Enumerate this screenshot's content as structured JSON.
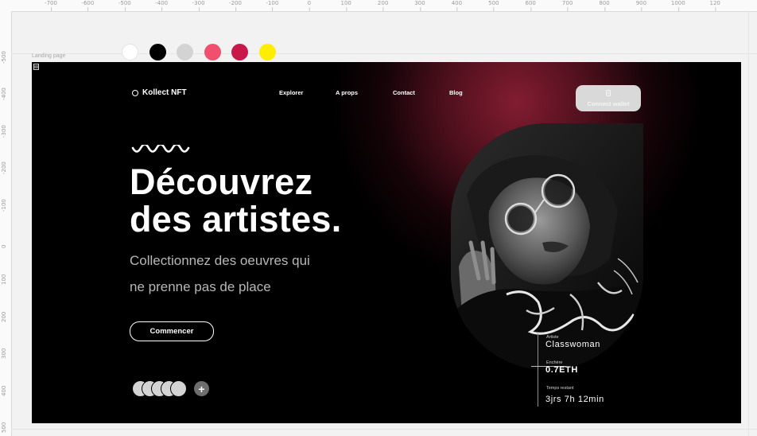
{
  "ruler": {
    "top": [
      "-700",
      "-600",
      "-500",
      "-400",
      "-300",
      "-200",
      "-100",
      "0",
      "100",
      "200",
      "300",
      "400",
      "500",
      "600",
      "700",
      "800",
      "900",
      "1000",
      "120"
    ],
    "left": [
      "-500",
      "-400",
      "-300",
      "-200",
      "-100",
      "0",
      "100",
      "200",
      "300",
      "400",
      "500"
    ]
  },
  "palette": [
    "#ffffff",
    "#000000",
    "#d3d3d3",
    "#f0506e",
    "#c8184b",
    "#ffee00"
  ],
  "frame_label": "Landing page",
  "nav": {
    "logo_text": "Kollect NFT",
    "links": [
      "Explorer",
      "A props",
      "Contact",
      "Blog"
    ],
    "connect_label": "Connect wallet"
  },
  "hero": {
    "headline_1": "Découvrez",
    "headline_2": "des artistes.",
    "subtitle_1": "Collectionnez des oeuvres qui",
    "subtitle_2": "ne prenne pas de place",
    "cta_label": "Commencer",
    "add_label": "+"
  },
  "artwork": {
    "artist_label": "Artiste",
    "artist_name": "Classwoman",
    "bid_label": "Enchère",
    "bid_value": "0.7ETH",
    "time_label": "Temps restant",
    "time_value": "3jrs 7h 12min"
  },
  "colors": {
    "accent": "#8a1e34",
    "background": "#000000",
    "connect_button": "#d9d9d9"
  }
}
